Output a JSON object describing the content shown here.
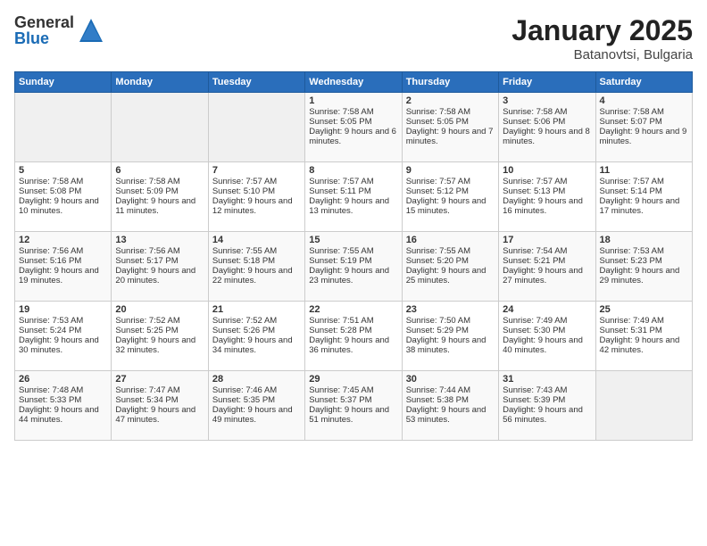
{
  "logo": {
    "general": "General",
    "blue": "Blue"
  },
  "title": "January 2025",
  "location": "Batanovtsi, Bulgaria",
  "days_header": [
    "Sunday",
    "Monday",
    "Tuesday",
    "Wednesday",
    "Thursday",
    "Friday",
    "Saturday"
  ],
  "weeks": [
    [
      {
        "day": "",
        "info": ""
      },
      {
        "day": "",
        "info": ""
      },
      {
        "day": "",
        "info": ""
      },
      {
        "day": "1",
        "info": "Sunrise: 7:58 AM\nSunset: 5:05 PM\nDaylight: 9 hours and 6 minutes."
      },
      {
        "day": "2",
        "info": "Sunrise: 7:58 AM\nSunset: 5:05 PM\nDaylight: 9 hours and 7 minutes."
      },
      {
        "day": "3",
        "info": "Sunrise: 7:58 AM\nSunset: 5:06 PM\nDaylight: 9 hours and 8 minutes."
      },
      {
        "day": "4",
        "info": "Sunrise: 7:58 AM\nSunset: 5:07 PM\nDaylight: 9 hours and 9 minutes."
      }
    ],
    [
      {
        "day": "5",
        "info": "Sunrise: 7:58 AM\nSunset: 5:08 PM\nDaylight: 9 hours and 10 minutes."
      },
      {
        "day": "6",
        "info": "Sunrise: 7:58 AM\nSunset: 5:09 PM\nDaylight: 9 hours and 11 minutes."
      },
      {
        "day": "7",
        "info": "Sunrise: 7:57 AM\nSunset: 5:10 PM\nDaylight: 9 hours and 12 minutes."
      },
      {
        "day": "8",
        "info": "Sunrise: 7:57 AM\nSunset: 5:11 PM\nDaylight: 9 hours and 13 minutes."
      },
      {
        "day": "9",
        "info": "Sunrise: 7:57 AM\nSunset: 5:12 PM\nDaylight: 9 hours and 15 minutes."
      },
      {
        "day": "10",
        "info": "Sunrise: 7:57 AM\nSunset: 5:13 PM\nDaylight: 9 hours and 16 minutes."
      },
      {
        "day": "11",
        "info": "Sunrise: 7:57 AM\nSunset: 5:14 PM\nDaylight: 9 hours and 17 minutes."
      }
    ],
    [
      {
        "day": "12",
        "info": "Sunrise: 7:56 AM\nSunset: 5:16 PM\nDaylight: 9 hours and 19 minutes."
      },
      {
        "day": "13",
        "info": "Sunrise: 7:56 AM\nSunset: 5:17 PM\nDaylight: 9 hours and 20 minutes."
      },
      {
        "day": "14",
        "info": "Sunrise: 7:55 AM\nSunset: 5:18 PM\nDaylight: 9 hours and 22 minutes."
      },
      {
        "day": "15",
        "info": "Sunrise: 7:55 AM\nSunset: 5:19 PM\nDaylight: 9 hours and 23 minutes."
      },
      {
        "day": "16",
        "info": "Sunrise: 7:55 AM\nSunset: 5:20 PM\nDaylight: 9 hours and 25 minutes."
      },
      {
        "day": "17",
        "info": "Sunrise: 7:54 AM\nSunset: 5:21 PM\nDaylight: 9 hours and 27 minutes."
      },
      {
        "day": "18",
        "info": "Sunrise: 7:53 AM\nSunset: 5:23 PM\nDaylight: 9 hours and 29 minutes."
      }
    ],
    [
      {
        "day": "19",
        "info": "Sunrise: 7:53 AM\nSunset: 5:24 PM\nDaylight: 9 hours and 30 minutes."
      },
      {
        "day": "20",
        "info": "Sunrise: 7:52 AM\nSunset: 5:25 PM\nDaylight: 9 hours and 32 minutes."
      },
      {
        "day": "21",
        "info": "Sunrise: 7:52 AM\nSunset: 5:26 PM\nDaylight: 9 hours and 34 minutes."
      },
      {
        "day": "22",
        "info": "Sunrise: 7:51 AM\nSunset: 5:28 PM\nDaylight: 9 hours and 36 minutes."
      },
      {
        "day": "23",
        "info": "Sunrise: 7:50 AM\nSunset: 5:29 PM\nDaylight: 9 hours and 38 minutes."
      },
      {
        "day": "24",
        "info": "Sunrise: 7:49 AM\nSunset: 5:30 PM\nDaylight: 9 hours and 40 minutes."
      },
      {
        "day": "25",
        "info": "Sunrise: 7:49 AM\nSunset: 5:31 PM\nDaylight: 9 hours and 42 minutes."
      }
    ],
    [
      {
        "day": "26",
        "info": "Sunrise: 7:48 AM\nSunset: 5:33 PM\nDaylight: 9 hours and 44 minutes."
      },
      {
        "day": "27",
        "info": "Sunrise: 7:47 AM\nSunset: 5:34 PM\nDaylight: 9 hours and 47 minutes."
      },
      {
        "day": "28",
        "info": "Sunrise: 7:46 AM\nSunset: 5:35 PM\nDaylight: 9 hours and 49 minutes."
      },
      {
        "day": "29",
        "info": "Sunrise: 7:45 AM\nSunset: 5:37 PM\nDaylight: 9 hours and 51 minutes."
      },
      {
        "day": "30",
        "info": "Sunrise: 7:44 AM\nSunset: 5:38 PM\nDaylight: 9 hours and 53 minutes."
      },
      {
        "day": "31",
        "info": "Sunrise: 7:43 AM\nSunset: 5:39 PM\nDaylight: 9 hours and 56 minutes."
      },
      {
        "day": "",
        "info": ""
      }
    ]
  ]
}
